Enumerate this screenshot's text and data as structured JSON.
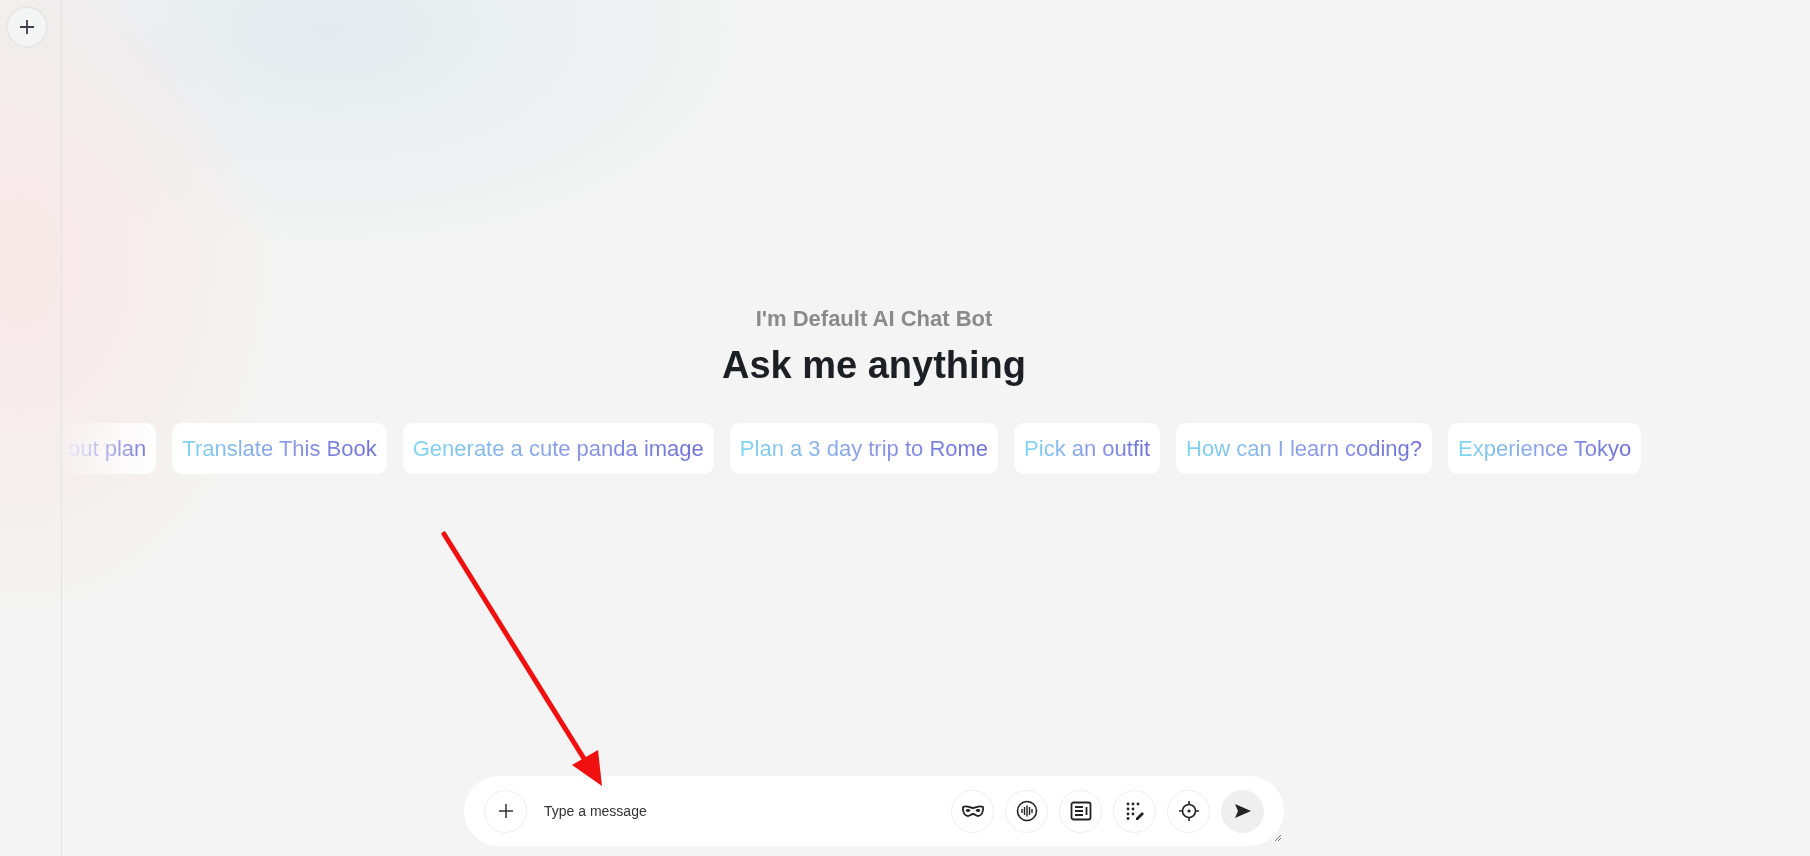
{
  "header": {
    "subtitle": "I'm Default AI Chat Bot",
    "title": "Ask me anything"
  },
  "suggestions": [
    {
      "label": "out plan",
      "kind": "faded"
    },
    {
      "label": "Translate This Book",
      "kind": "normal"
    },
    {
      "label": "Generate a cute panda image",
      "kind": "normal"
    },
    {
      "label": "Plan a 3 day trip to Rome",
      "kind": "normal"
    },
    {
      "label": "Pick an outfit",
      "kind": "normal"
    },
    {
      "label": "How can I learn coding?",
      "kind": "normal"
    },
    {
      "label": "Experience Tokyo",
      "kind": "normal"
    }
  ],
  "composer": {
    "placeholder": "Type a message"
  }
}
